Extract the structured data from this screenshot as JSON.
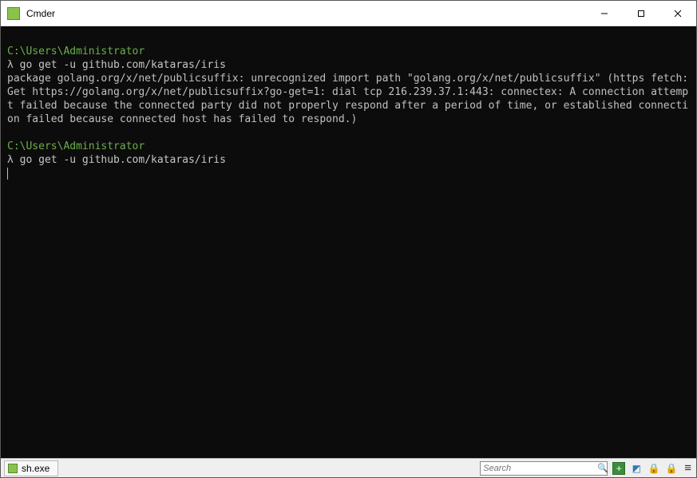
{
  "window": {
    "title": "Cmder"
  },
  "terminal": {
    "block1": {
      "prompt_path": "C:\\Users\\Administrator",
      "prompt_symbol": "λ",
      "command": "go get -u github.com/kataras/iris",
      "output": "package golang.org/x/net/publicsuffix: unrecognized import path \"golang.org/x/net/publicsuffix\" (https fetch: Get https://golang.org/x/net/publicsuffix?go-get=1: dial tcp 216.239.37.1:443: connectex: A connection attempt failed because the connected party did not properly respond after a period of time, or established connection failed because connected host has failed to respond.)"
    },
    "block2": {
      "prompt_path": "C:\\Users\\Administrator",
      "prompt_symbol": "λ",
      "command": "go get -u github.com/kataras/iris"
    }
  },
  "statusbar": {
    "active_tab": "sh.exe",
    "search_placeholder": "Search"
  },
  "icons": {
    "minimize": "—",
    "maximize": "□",
    "close": "✕",
    "plus": "+",
    "menu": "≡",
    "lock": "🔒",
    "magnifier": "🔍"
  }
}
